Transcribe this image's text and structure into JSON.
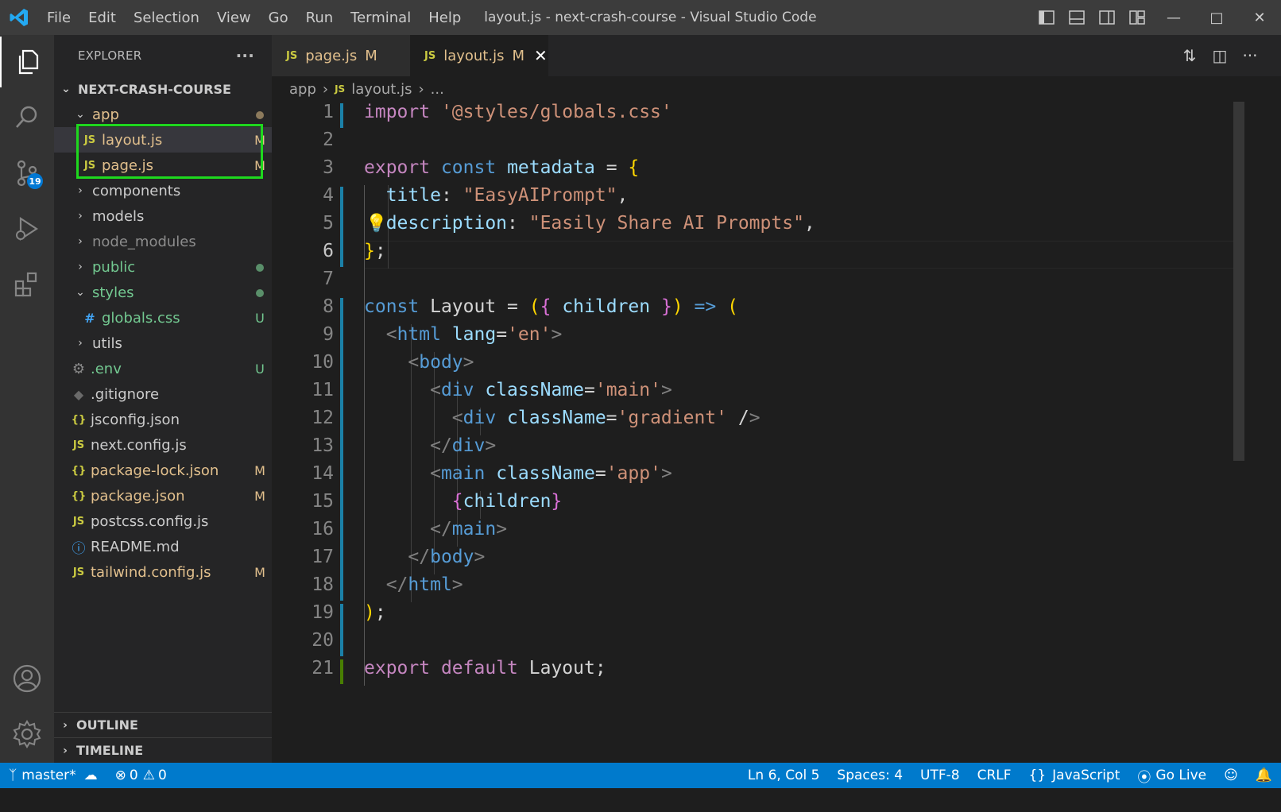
{
  "titlebar": {
    "menu": [
      "File",
      "Edit",
      "Selection",
      "View",
      "Go",
      "Run",
      "Terminal",
      "Help"
    ],
    "title": "layout.js - next-crash-course - Visual Studio Code"
  },
  "activity_bar": {
    "items": [
      "explorer-icon",
      "search-icon",
      "source-control-icon",
      "run-debug-icon",
      "extensions-icon"
    ],
    "scm_badge": "19",
    "bottom": [
      "account-icon",
      "settings-gear-icon"
    ]
  },
  "sidebar": {
    "header": "EXPLORER",
    "more": "···",
    "root": "NEXT-CRASH-COURSE",
    "tree": [
      {
        "name": "app",
        "type": "folder",
        "open": true,
        "status": "dot",
        "depth": 1
      },
      {
        "name": "layout.js",
        "type": "js",
        "status": "M",
        "depth": 2,
        "selected": true
      },
      {
        "name": "page.js",
        "type": "js",
        "status": "M",
        "depth": 2
      },
      {
        "name": "components",
        "type": "folder",
        "open": false,
        "status": "",
        "depth": 1
      },
      {
        "name": "models",
        "type": "folder",
        "open": false,
        "status": "",
        "depth": 1
      },
      {
        "name": "node_modules",
        "type": "folder",
        "open": false,
        "status": "",
        "depth": 1,
        "dim": true
      },
      {
        "name": "public",
        "type": "folder",
        "open": false,
        "status": "dot-green",
        "depth": 1
      },
      {
        "name": "styles",
        "type": "folder",
        "open": true,
        "status": "dot-green",
        "depth": 1
      },
      {
        "name": "globals.css",
        "type": "css",
        "status": "U",
        "depth": 2
      },
      {
        "name": "utils",
        "type": "folder",
        "open": false,
        "status": "",
        "depth": 1
      },
      {
        "name": ".env",
        "type": "env",
        "status": "U",
        "depth": 1
      },
      {
        "name": ".gitignore",
        "type": "git",
        "status": "",
        "depth": 1
      },
      {
        "name": "jsconfig.json",
        "type": "json",
        "status": "",
        "depth": 1
      },
      {
        "name": "next.config.js",
        "type": "js",
        "status": "",
        "depth": 1
      },
      {
        "name": "package-lock.json",
        "type": "json",
        "status": "M",
        "depth": 1
      },
      {
        "name": "package.json",
        "type": "json",
        "status": "M",
        "depth": 1
      },
      {
        "name": "postcss.config.js",
        "type": "js",
        "status": "",
        "depth": 1
      },
      {
        "name": "README.md",
        "type": "info",
        "status": "",
        "depth": 1
      },
      {
        "name": "tailwind.config.js",
        "type": "js",
        "status": "M",
        "depth": 1
      }
    ],
    "outline": "OUTLINE",
    "timeline": "TIMELINE"
  },
  "tabs": [
    {
      "label": "page.js",
      "status": "M",
      "active": false
    },
    {
      "label": "layout.js",
      "status": "M",
      "active": true
    }
  ],
  "breadcrumb": {
    "folder": "app",
    "file": "layout.js",
    "more": "..."
  },
  "editor": {
    "current_line": 6,
    "lines": [
      "import '@styles/globals.css'",
      "",
      "export const metadata = {",
      "  title: \"EasyAIPrompt\",",
      "  description: \"Easily Share AI Prompts\",",
      "};",
      "",
      "const Layout = ({ children }) => (",
      "  <html lang='en'>",
      "    <body>",
      "      <div className='main'>",
      "        <div className='gradient' />",
      "      </div>",
      "      <main className='app'>",
      "        {children}",
      "      </main>",
      "    </body>",
      "  </html>",
      ");",
      "",
      "export default Layout;"
    ]
  },
  "statusbar": {
    "branch": "master*",
    "errors": "0",
    "warnings": "0",
    "position": "Ln 6, Col 5",
    "spaces": "Spaces: 4",
    "encoding": "UTF-8",
    "eol": "CRLF",
    "language": "JavaScript",
    "golive": "Go Live"
  },
  "colors": {
    "accent": "#007acc",
    "highlight_box": "#1ed81e",
    "modified": "#e2c08d",
    "untracked": "#73c991"
  }
}
